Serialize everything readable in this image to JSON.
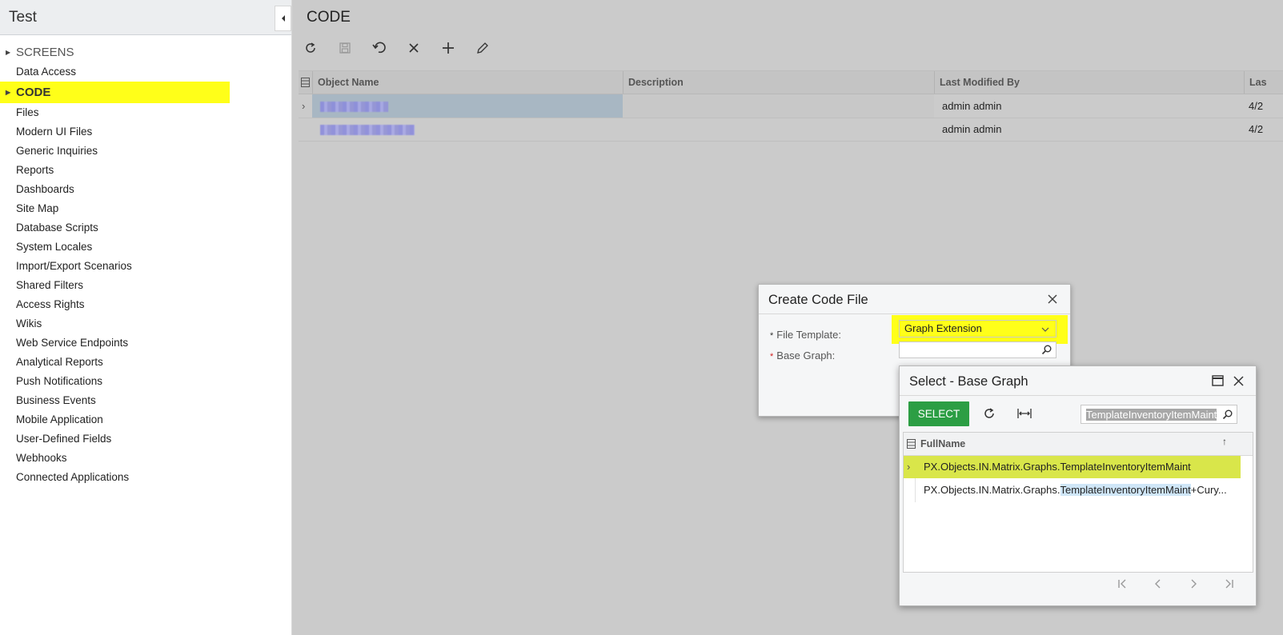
{
  "sidebar": {
    "title": "Test",
    "items": [
      {
        "label": "SCREENS"
      },
      {
        "label": "Data Access"
      },
      {
        "label": "CODE"
      },
      {
        "label": "Files"
      },
      {
        "label": "Modern UI Files"
      },
      {
        "label": "Generic Inquiries"
      },
      {
        "label": "Reports"
      },
      {
        "label": "Dashboards"
      },
      {
        "label": "Site Map"
      },
      {
        "label": "Database Scripts"
      },
      {
        "label": "System Locales"
      },
      {
        "label": "Import/Export Scenarios"
      },
      {
        "label": "Shared Filters"
      },
      {
        "label": "Access Rights"
      },
      {
        "label": "Wikis"
      },
      {
        "label": "Web Service Endpoints"
      },
      {
        "label": "Analytical Reports"
      },
      {
        "label": "Push Notifications"
      },
      {
        "label": "Business Events"
      },
      {
        "label": "Mobile Application"
      },
      {
        "label": "User-Defined Fields"
      },
      {
        "label": "Webhooks"
      },
      {
        "label": "Connected Applications"
      }
    ]
  },
  "main": {
    "title": "CODE",
    "grid": {
      "columns": [
        "Object Name",
        "Description",
        "Last Modified By",
        "Las"
      ],
      "rows": [
        {
          "description": "",
          "modified_by": "admin admin",
          "last": "4/2"
        },
        {
          "description": "",
          "modified_by": "admin admin",
          "last": "4/2"
        }
      ]
    }
  },
  "create_dialog": {
    "title": "Create Code File",
    "file_template_label": "File Template:",
    "file_template_value": "Graph Extension",
    "base_graph_label": "Base Graph:",
    "base_graph_value": ""
  },
  "select_dialog": {
    "title": "Select - Base Graph",
    "select_label": "SELECT",
    "search_value": "TemplateInventoryItemMaint",
    "column": "FullName",
    "rows": [
      {
        "prefix": "PX.Objects.IN.Matrix.Graphs.",
        "match": "TemplateInventoryItemMaint",
        "suffix": ""
      },
      {
        "prefix": "PX.Objects.IN.Matrix.Graphs.",
        "match": "TemplateInventoryItemMaint",
        "suffix": "+Cury..."
      }
    ]
  },
  "colors": {
    "highlight": "#ffff19",
    "select_button": "#2c9e44",
    "selected_row": "#d9e64a",
    "grid_selected_row": "#a8b7c3",
    "main_background": "#cbcbcb"
  }
}
